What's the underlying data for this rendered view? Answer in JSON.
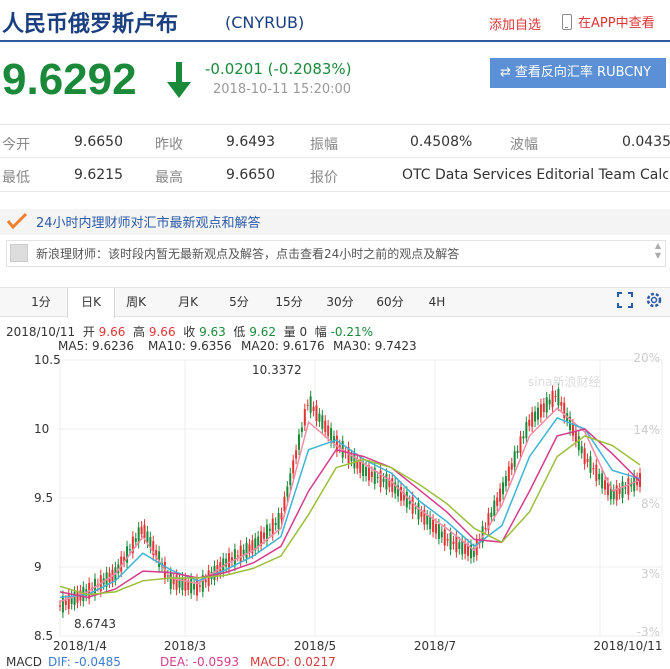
{
  "header": {
    "title": "人民币俄罗斯卢布",
    "code": "(CNYRUB)",
    "add_favorite": "添加自选",
    "app_link": "在APP中查看"
  },
  "quote": {
    "price": "9.6292",
    "change": "-0.0201 (-0.2083%)",
    "time": "2018-10-11 15:20:00",
    "reverse_button": "查看反向汇率 RUBCNY",
    "colors": {
      "down": "#1a8a3a",
      "up": "#e13535",
      "button": "#5b8fd6"
    }
  },
  "stats": {
    "row1": [
      {
        "label": "今开",
        "value": "9.6650"
      },
      {
        "label": "昨收",
        "value": "9.6493"
      },
      {
        "label": "振幅",
        "value": "0.4508%"
      },
      {
        "label": "波幅",
        "value": "0.0435"
      }
    ],
    "row2": [
      {
        "label": "最低",
        "value": "9.6215"
      },
      {
        "label": "最高",
        "value": "9.6650"
      },
      {
        "label": "报价",
        "value": "OTC Data Services Editorial Team Calc..."
      }
    ]
  },
  "commentary": {
    "title": "24小时内理财师对汇市最新观点和解答",
    "notice": "新浪理财师：该时段内暂无最新观点及解答，点击查看24小时之前的观点及解答"
  },
  "tabs": [
    {
      "label": "1分"
    },
    {
      "label": "日K"
    },
    {
      "label": "周K"
    },
    {
      "label": "月K"
    },
    {
      "label": "5分"
    },
    {
      "label": "15分"
    },
    {
      "label": "30分"
    },
    {
      "label": "60分"
    },
    {
      "label": "4H"
    }
  ],
  "active_tab": "日K",
  "ohlc": {
    "date": "2018/10/11",
    "open_label": "开",
    "open": "9.66",
    "high_label": "高",
    "high": "9.66",
    "close_label": "收",
    "close": "9.63",
    "low_label": "低",
    "low": "9.62",
    "vol_label": "量",
    "vol": "0",
    "amp_label": "幅",
    "amp": "-0.21%"
  },
  "ma": [
    {
      "label": "MA5: 9.6236",
      "color": "#f08ca5"
    },
    {
      "label": "MA10: 9.6356",
      "color": "#3cb4d6"
    },
    {
      "label": "MA20: 9.6176",
      "color": "#d63c8c"
    },
    {
      "label": "MA30: 9.7423",
      "color": "#9bbf3a"
    }
  ],
  "macd": {
    "label": "MACD",
    "dif": "DIF: -0.0485",
    "dea": "DEA: -0.0593",
    "macd": "MACD: 0.0217"
  },
  "chart_data": {
    "type": "candlestick",
    "y_ticks": [
      "10.5",
      "10",
      "9.5",
      "9",
      "8.5"
    ],
    "ylim": [
      8.5,
      10.5
    ],
    "pct_ticks": [
      "20%",
      "14%",
      "8%",
      "3%",
      "-3%"
    ],
    "x_ticks": [
      "2018/1/4",
      "2018/3",
      "2018/5",
      "2018/7",
      "2018/10/11"
    ],
    "annotations": {
      "max": "10.3372",
      "min": "8.6743"
    },
    "watermark": "sina新浪财经",
    "colors": {
      "up": "#e13535",
      "down": "#1a8a3a",
      "grid": "#ececec"
    },
    "ma_series_values": {
      "MA5": [
        8.75,
        8.82,
        8.95,
        9.22,
        8.92,
        8.88,
        9.02,
        9.12,
        9.28,
        10.05,
        9.88,
        9.75,
        9.62,
        9.42,
        9.28,
        9.12,
        9.45,
        9.95,
        10.15,
        9.98,
        9.55,
        9.63
      ],
      "MA10": [
        8.78,
        8.8,
        8.9,
        9.1,
        8.98,
        8.9,
        8.98,
        9.08,
        9.22,
        9.85,
        9.92,
        9.78,
        9.68,
        9.48,
        9.33,
        9.15,
        9.3,
        9.8,
        10.08,
        10.0,
        9.7,
        9.64
      ],
      "MA20": [
        8.82,
        8.78,
        8.84,
        8.97,
        8.96,
        8.92,
        8.96,
        9.03,
        9.15,
        9.55,
        9.85,
        9.8,
        9.72,
        9.56,
        9.4,
        9.2,
        9.18,
        9.55,
        9.95,
        10.0,
        9.82,
        9.62
      ],
      "MA30": [
        8.86,
        8.8,
        8.82,
        8.9,
        8.92,
        8.92,
        8.94,
        8.99,
        9.08,
        9.38,
        9.72,
        9.78,
        9.72,
        9.6,
        9.46,
        9.28,
        9.18,
        9.4,
        9.8,
        9.95,
        9.88,
        9.74
      ]
    },
    "candle_values": [
      8.72,
      8.82,
      8.95,
      9.28,
      8.9,
      8.85,
      9.03,
      9.15,
      9.35,
      10.2,
      9.9,
      9.7,
      9.6,
      9.4,
      9.2,
      9.1,
      9.55,
      10.05,
      10.25,
      9.8,
      9.52,
      9.63
    ]
  }
}
